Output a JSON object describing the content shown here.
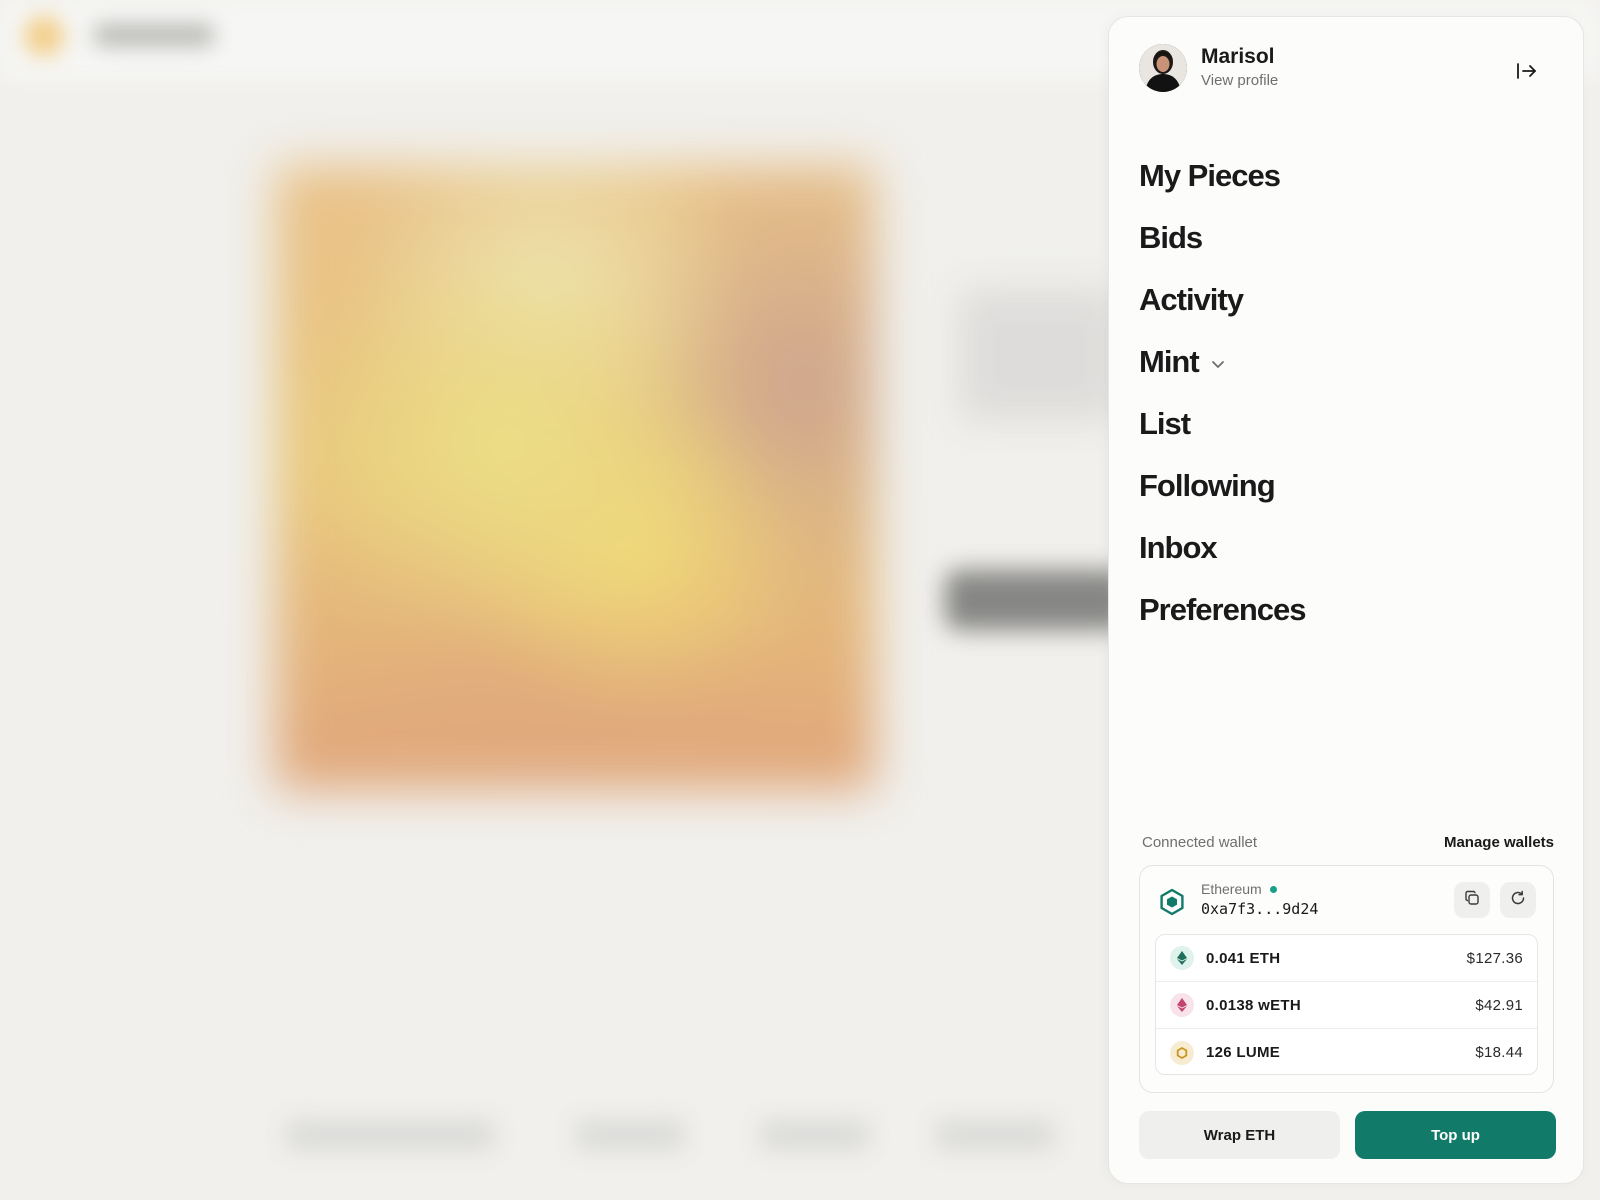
{
  "theme": {
    "accent": "#117a69",
    "text": "#1a1a1a",
    "muted": "#6f6f6c",
    "status_online": "#16a085"
  },
  "profile": {
    "name": "Marisol",
    "link_label": "View profile",
    "logout_icon": "logout-icon"
  },
  "nav": {
    "items": [
      {
        "label": "My Pieces"
      },
      {
        "label": "Bids"
      },
      {
        "label": "Activity"
      },
      {
        "label": "Mint",
        "icon": "chevron-down-icon"
      },
      {
        "label": "List"
      },
      {
        "label": "Following"
      },
      {
        "label": "Inbox"
      },
      {
        "label": "Preferences"
      }
    ]
  },
  "wallet": {
    "section_label": "Connected wallet",
    "manage_label": "Manage wallets",
    "network": "Ethereum",
    "address": "0xa7f3...9d24",
    "chain_icon": "hexagon-icon",
    "copy_icon": "copy-icon",
    "refresh_icon": "refresh-icon",
    "tokens": [
      {
        "amount": "0.041 ETH",
        "usd": "$127.36",
        "icon": "eth-icon",
        "color": "#1f6f5c",
        "bg": "#dff2ec"
      },
      {
        "amount": "0.0138 wETH",
        "usd": "$42.91",
        "icon": "weth-icon",
        "color": "#c2446e",
        "bg": "#f8e3ea"
      },
      {
        "amount": "126 LUME",
        "usd": "$18.44",
        "icon": "lume-icon",
        "color": "#c9961e",
        "bg": "#f7ecd2"
      }
    ]
  },
  "actions": {
    "wrap_label": "Wrap ETH",
    "topup_label": "Top up"
  }
}
